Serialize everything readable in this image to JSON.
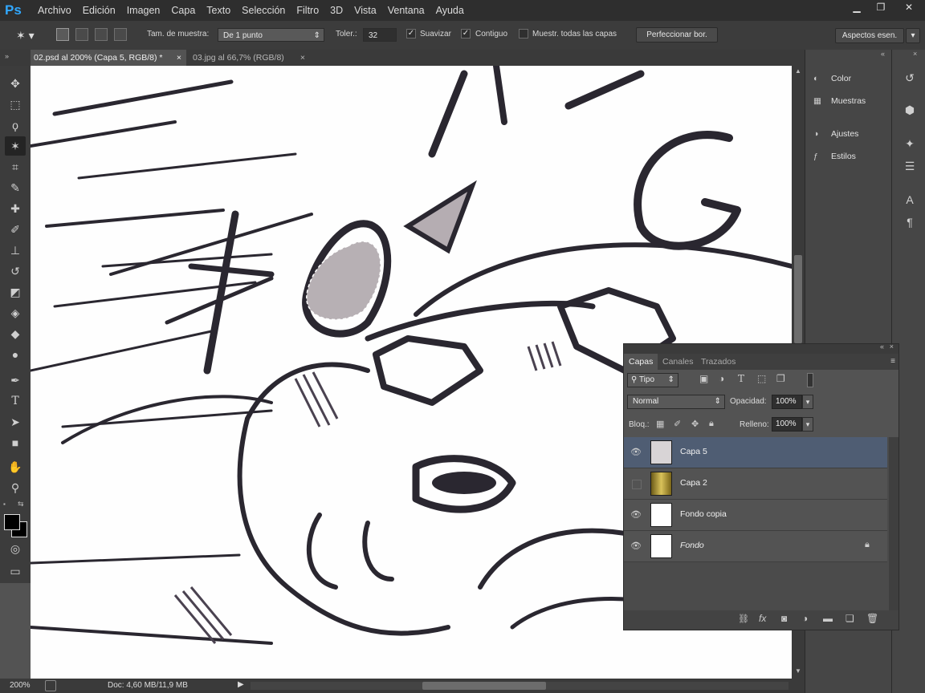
{
  "app": {
    "logo": "Ps"
  },
  "menu": [
    "Archivo",
    "Edición",
    "Imagen",
    "Capa",
    "Texto",
    "Selección",
    "Filtro",
    "3D",
    "Vista",
    "Ventana",
    "Ayuda"
  ],
  "window_controls": [
    "▁",
    "❐",
    "✕"
  ],
  "options": {
    "sample_size_label": "Tam. de muestra:",
    "sample_size_value": "De 1 punto",
    "tolerance_label": "Toler.:",
    "tolerance_value": "32",
    "antialias_label": "Suavizar",
    "contiguous_label": "Contiguo",
    "sample_all_label": "Muestr. todas las capas",
    "refine_button": "Perfeccionar bor.",
    "workspace_button": "Aspectos esen."
  },
  "tabs": [
    {
      "label": "02.psd al 200% (Capa 5, RGB/8) *",
      "close": "×",
      "active": true
    },
    {
      "label": "03.jpg al 66,7% (RGB/8)",
      "close": "×",
      "active": false
    }
  ],
  "status": {
    "zoom": "200%",
    "doc": "Doc: 4,60 MB/11,9 MB"
  },
  "dock": {
    "items": [
      {
        "label": "Color",
        "icon": "color-icon"
      },
      {
        "label": "Muestras",
        "icon": "swatches-icon"
      },
      {
        "label": "Ajustes",
        "icon": "adjustments-icon"
      },
      {
        "label": "Estilos",
        "icon": "styles-icon"
      }
    ]
  },
  "layers_panel": {
    "tabs": [
      "Capas",
      "Canales",
      "Trazados"
    ],
    "filter_label": "Tipo",
    "blend_mode": "Normal",
    "opacity_label": "Opacidad:",
    "opacity_value": "100%",
    "lock_label": "Bloq.:",
    "fill_label": "Relleno:",
    "fill_value": "100%",
    "layers": [
      {
        "name": "Capa 5",
        "visible": true,
        "selected": true
      },
      {
        "name": "Capa 2",
        "visible": false,
        "selected": false
      },
      {
        "name": "Fondo copia",
        "visible": true,
        "selected": false
      },
      {
        "name": "Fondo",
        "visible": true,
        "selected": false,
        "locked": true
      }
    ]
  },
  "colors": {
    "selection_row": "#4f5d73",
    "accent": "#31a8ff"
  }
}
